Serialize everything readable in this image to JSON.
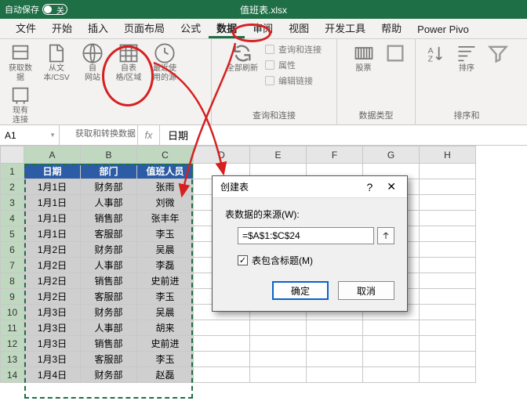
{
  "titlebar": {
    "autosave_label": "自动保存",
    "autosave_state": "关",
    "filename": "值班表.xlsx"
  },
  "tabs": [
    "文件",
    "开始",
    "插入",
    "页面布局",
    "公式",
    "数据",
    "审阅",
    "视图",
    "开发工具",
    "帮助",
    "Power Pivo"
  ],
  "tabs_active_index": 5,
  "ribbon": {
    "group1": {
      "label": "获取和转换数据",
      "items": [
        {
          "l1": "获取数",
          "l2": "据"
        },
        {
          "l1": "从文",
          "l2": "本/CSV"
        },
        {
          "l1": "自",
          "l2": "网站"
        },
        {
          "l1": "自表",
          "l2": "格/区域"
        },
        {
          "l1": "最近使",
          "l2": "用的源"
        },
        {
          "l1": "现有",
          "l2": "连接"
        }
      ]
    },
    "group2": {
      "label": "查询和连接",
      "large": {
        "l1": "全部刷新",
        "l2": ""
      },
      "small": [
        "查询和连接",
        "属性",
        "编辑链接"
      ]
    },
    "group3": {
      "label": "数据类型",
      "large": {
        "l1": "股票",
        "l2": ""
      }
    },
    "group4": {
      "label": "排序和",
      "left": {
        "l1": "↓",
        "l2": "排序"
      }
    }
  },
  "namebox": "A1",
  "formula": "日期",
  "columns": [
    "A",
    "B",
    "C",
    "D",
    "E",
    "F",
    "G",
    "H"
  ],
  "header_row": [
    "日期",
    "部门",
    "值班人员",
    "",
    "",
    "",
    "",
    ""
  ],
  "chart_data": {
    "type": "table",
    "columns": [
      "日期",
      "部门",
      "值班人员"
    ],
    "rows": [
      [
        "1月1日",
        "财务部",
        "张雨"
      ],
      [
        "1月1日",
        "人事部",
        "刘微"
      ],
      [
        "1月1日",
        "销售部",
        "张丰年"
      ],
      [
        "1月1日",
        "客服部",
        "李玉"
      ],
      [
        "1月2日",
        "财务部",
        "吴晨"
      ],
      [
        "1月2日",
        "人事部",
        "李磊"
      ],
      [
        "1月2日",
        "销售部",
        "史前进"
      ],
      [
        "1月2日",
        "客服部",
        "李玉"
      ],
      [
        "1月3日",
        "财务部",
        "吴晨"
      ],
      [
        "1月3日",
        "人事部",
        "胡来"
      ],
      [
        "1月3日",
        "销售部",
        "史前进"
      ],
      [
        "1月3日",
        "客服部",
        "李玉"
      ],
      [
        "1月4日",
        "财务部",
        "赵磊"
      ]
    ]
  },
  "dialog": {
    "title": "创建表",
    "help": "?",
    "source_label": "表数据的来源(W):",
    "source_value": "=$A$1:$C$24",
    "headers_label": "表包含标题(M)",
    "headers_checked": true,
    "ok": "确定",
    "cancel": "取消"
  }
}
